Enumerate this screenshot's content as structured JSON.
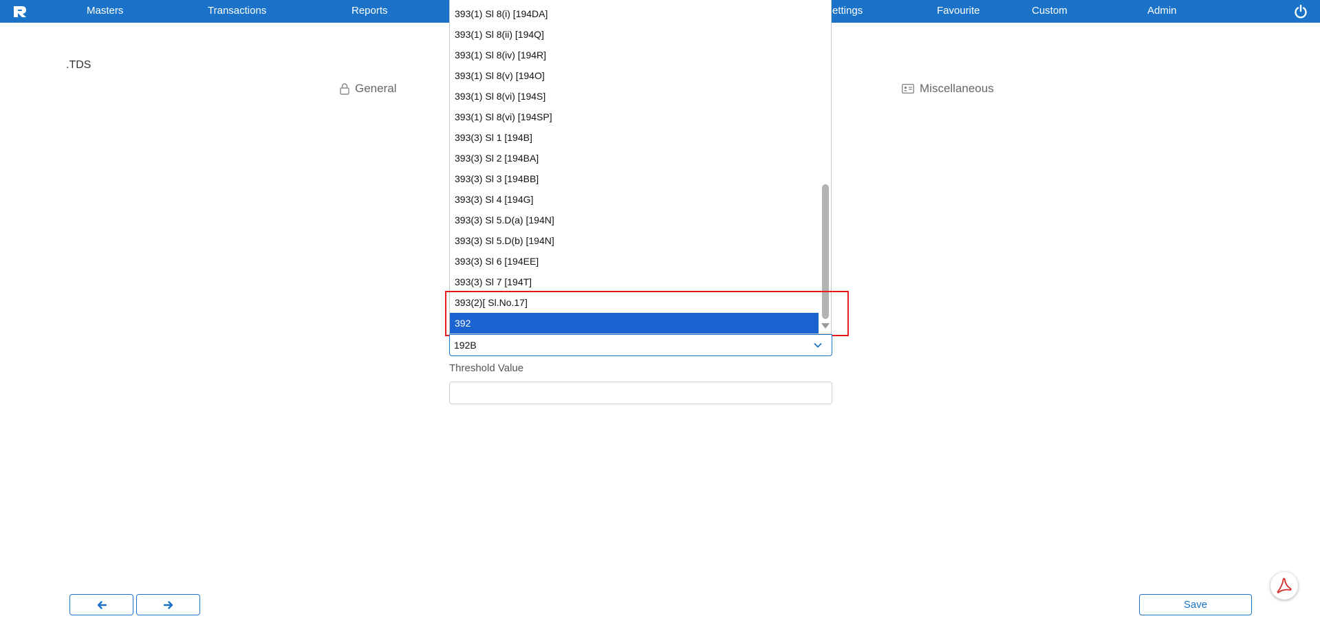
{
  "navbar": {
    "items": [
      "Masters",
      "Transactions",
      "Reports",
      "ettings",
      "Favourite",
      "Custom",
      "Admin"
    ]
  },
  "page": {
    "title": ".TDS",
    "tabs": {
      "general": "General",
      "miscellaneous": "Miscellaneous"
    }
  },
  "dropdown": {
    "options": [
      "393(1) Sl 8(i) [194DA]",
      "393(1) Sl 8(ii) [194Q]",
      "393(1) Sl 8(iv) [194R]",
      "393(1) Sl 8(v) [194O]",
      "393(1) Sl 8(vi) [194S]",
      "393(1) Sl 8(vi) [194SP]",
      "393(3) Sl 1 [194B]",
      "393(3) Sl 2 [194BA]",
      "393(3) Sl 3 [194BB]",
      "393(3) Sl 4 [194G]",
      "393(3) Sl 5.D(a) [194N]",
      "393(3) Sl 5.D(b) [194N]",
      "393(3) Sl 6 [194EE]",
      "393(3) Sl 7 [194T]",
      "393(2)[ Sl.No.17]",
      "392"
    ],
    "selected": "392"
  },
  "form": {
    "section_value": "192B",
    "threshold_label": "Threshold Value",
    "threshold_value": ""
  },
  "footer": {
    "save_label": "Save"
  },
  "colors": {
    "navbar": "#1a73c8",
    "selected_option": "#1b63d0",
    "highlight": "#e41b1b",
    "pdf_icon": "#d62b2b"
  },
  "icons": {
    "logo": "app-logo-icon",
    "power": "power-icon",
    "general_tab": "lock-icon",
    "misc_tab": "id-card-icon",
    "prev": "arrow-left-icon",
    "next": "arrow-right-icon",
    "pdf": "pdf-icon",
    "chevron": "chevron-down-icon"
  }
}
